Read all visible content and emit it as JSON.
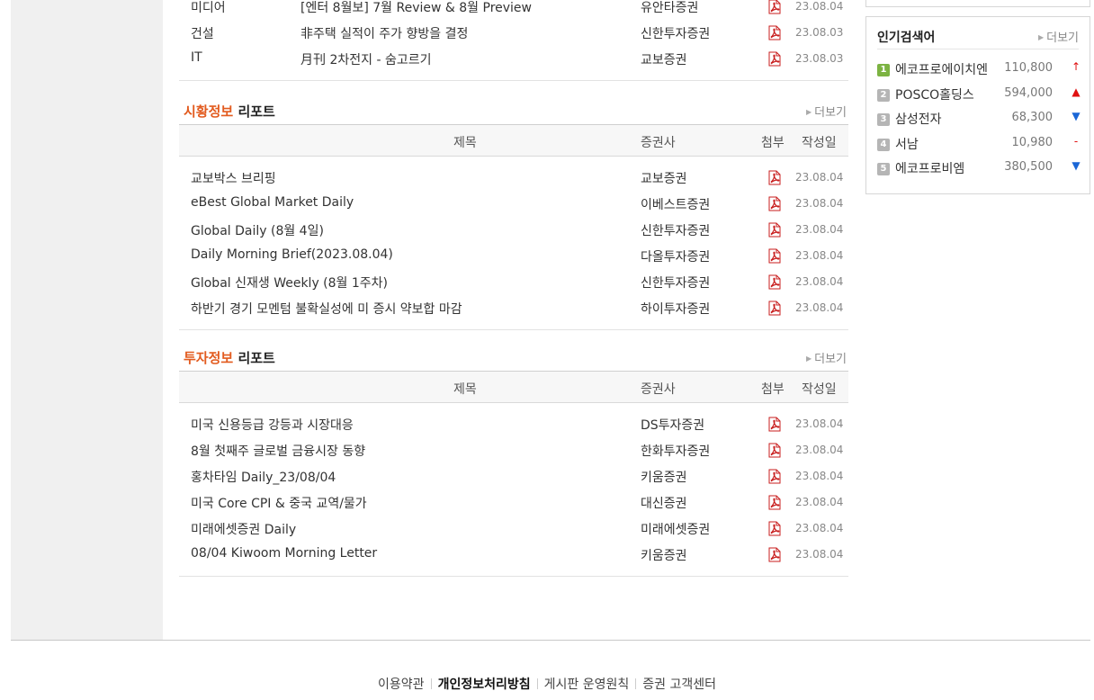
{
  "top_rows": [
    {
      "category": "미디어",
      "title": "[엔터 8월보] 7월 Review & 8월 Preview",
      "broker": "유안타증권",
      "date": "23.08.04"
    },
    {
      "category": "건설",
      "title": "非주택 실적이 주가 향방을 결정",
      "broker": "신한투자증권",
      "date": "23.08.03"
    },
    {
      "category": "IT",
      "title": "月刊 2차전지 - 숨고르기",
      "broker": "교보증권",
      "date": "23.08.03"
    }
  ],
  "market_section": {
    "title_accent": "시황정보",
    "title_rest": "리포트",
    "more_label": "더보기",
    "headers": {
      "title": "제목",
      "broker": "증권사",
      "attachment": "첨부",
      "date": "작성일"
    },
    "rows": [
      {
        "title": "교보박스 브리핑",
        "broker": "교보증권",
        "date": "23.08.04"
      },
      {
        "title": "eBest Global Market Daily",
        "broker": "이베스트증권",
        "date": "23.08.04"
      },
      {
        "title": "Global Daily (8월 4일)",
        "broker": "신한투자증권",
        "date": "23.08.04"
      },
      {
        "title": "Daily Morning Brief(2023.08.04)",
        "broker": "다올투자증권",
        "date": "23.08.04"
      },
      {
        "title": "Global 신재생 Weekly (8월 1주차)",
        "broker": "신한투자증권",
        "date": "23.08.04"
      },
      {
        "title": "하반기 경기 모멘텀 불확실성에 미 증시 약보합 마감",
        "broker": "하이투자증권",
        "date": "23.08.04"
      }
    ]
  },
  "invest_section": {
    "title_accent": "투자정보",
    "title_rest": "리포트",
    "more_label": "더보기",
    "headers": {
      "title": "제목",
      "broker": "증권사",
      "attachment": "첨부",
      "date": "작성일"
    },
    "rows": [
      {
        "title": "미국 신용등급 강등과 시장대응",
        "broker": "DS투자증권",
        "date": "23.08.04"
      },
      {
        "title": "8월 첫째주 글로벌 금융시장 동향",
        "broker": "한화투자증권",
        "date": "23.08.04"
      },
      {
        "title": "홍차타임 Daily_23/08/04",
        "broker": "키움증권",
        "date": "23.08.04"
      },
      {
        "title": "미국 Core CPI & 중국 교역/물가",
        "broker": "대신증권",
        "date": "23.08.04"
      },
      {
        "title": "미래에셋증권 Daily",
        "broker": "미래에셋증권",
        "date": "23.08.04"
      },
      {
        "title": "08/04 Kiwoom Morning Letter",
        "broker": "키움증권",
        "date": "23.08.04"
      }
    ]
  },
  "popular": {
    "title": "인기검색어",
    "more_label": "더보기",
    "items": [
      {
        "rank": "1",
        "keyword": "에코프로에이치엔",
        "price": "110,800",
        "trend": "upper-limit",
        "trend_glyph": "↑",
        "color": "#e01010"
      },
      {
        "rank": "2",
        "keyword": "POSCO홀딩스",
        "price": "594,000",
        "trend": "up",
        "trend_glyph": "▲",
        "color": "#e01010"
      },
      {
        "rank": "3",
        "keyword": "삼성전자",
        "price": "68,300",
        "trend": "down",
        "trend_glyph": "▼",
        "color": "#1a66d6"
      },
      {
        "rank": "4",
        "keyword": "서남",
        "price": "10,980",
        "trend": "flat",
        "trend_glyph": "-",
        "color": "#e01010"
      },
      {
        "rank": "5",
        "keyword": "에코프로비엠",
        "price": "380,500",
        "trend": "down",
        "trend_glyph": "▼",
        "color": "#1a66d6"
      }
    ]
  },
  "footer": {
    "terms": "이용약관",
    "privacy": "개인정보처리방침",
    "board_policy": "게시판 운영원칙",
    "customer_center": "증권 고객센터"
  },
  "icons": {
    "attachment": "pdf-icon",
    "more": "triangle-right-icon"
  }
}
